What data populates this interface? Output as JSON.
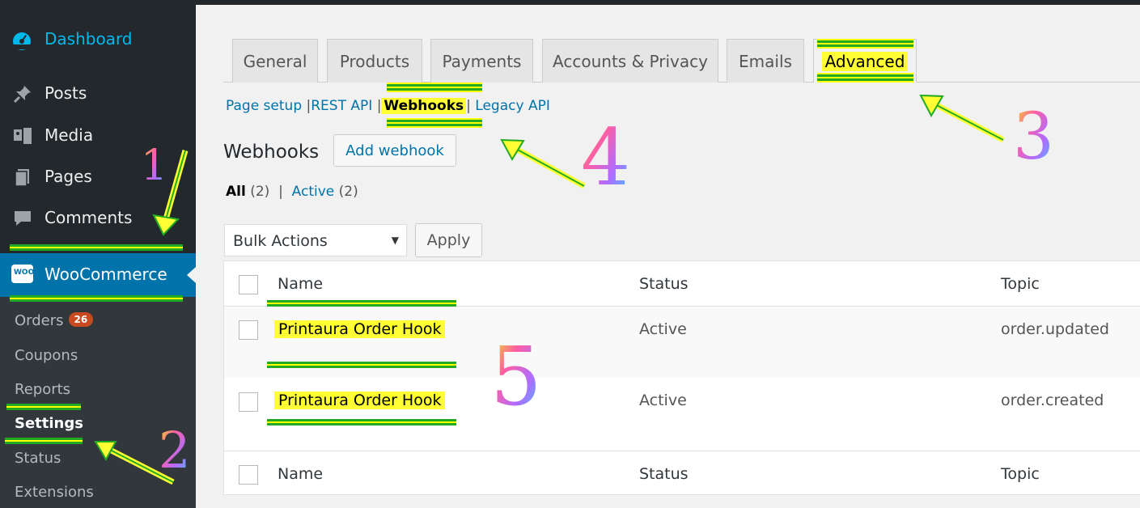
{
  "sidebar": {
    "dashboard": "Dashboard",
    "items": [
      {
        "label": "Posts",
        "icon": "pin-icon"
      },
      {
        "label": "Media",
        "icon": "media-icon"
      },
      {
        "label": "Pages",
        "icon": "pages-icon"
      },
      {
        "label": "Comments",
        "icon": "comment-icon"
      }
    ],
    "woocommerce": "WooCommerce",
    "woo_icon_text": "WOO",
    "submenu": {
      "orders": "Orders",
      "orders_badge": "26",
      "coupons": "Coupons",
      "reports": "Reports",
      "settings": "Settings",
      "status": "Status",
      "extensions": "Extensions"
    }
  },
  "tabs": [
    "General",
    "Products",
    "Payments",
    "Accounts & Privacy",
    "Emails",
    "Advanced"
  ],
  "sublinks": {
    "page_setup": "Page setup",
    "rest_api": "REST API",
    "webhooks": "Webhooks",
    "legacy_api": "Legacy API",
    "sep": "|"
  },
  "page": {
    "title": "Webhooks",
    "add_button": "Add webhook"
  },
  "filters": {
    "all": "All",
    "all_count": "(2)",
    "sep": "|",
    "active": "Active",
    "active_count": "(2)"
  },
  "bulk": {
    "selected": "Bulk Actions",
    "apply": "Apply"
  },
  "table": {
    "columns": {
      "name": "Name",
      "status": "Status",
      "topic": "Topic"
    },
    "rows": [
      {
        "name": "Printaura Order Hook",
        "status": "Active",
        "topic": "order.updated"
      },
      {
        "name": "Printaura Order Hook",
        "status": "Active",
        "topic": "order.created"
      }
    ]
  },
  "annotations": [
    "1",
    "2",
    "3",
    "4",
    "5"
  ],
  "colors": {
    "highlight": "#ffff33",
    "annotation_stripe_green": "#22aa22",
    "wp_blue": "#0073aa",
    "sidebar_bg": "#23282d"
  }
}
